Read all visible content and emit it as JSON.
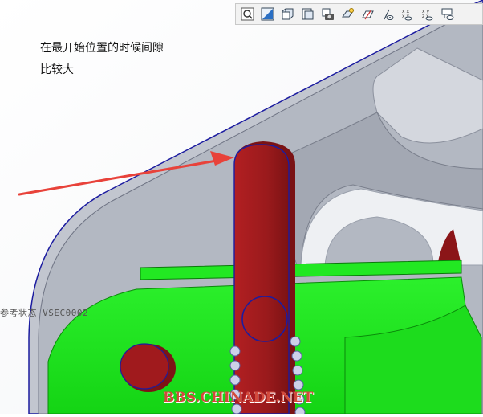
{
  "annotation": {
    "line1": "在最开始位置的时候间隙",
    "line2": "比较大"
  },
  "model_state_label": "参考状态 VSEC0002",
  "watermark": "BBS.CHINADE.NET",
  "toolbar": {
    "buttons": [
      {
        "icon": "zoom-icon"
      },
      {
        "icon": "shading-icon"
      },
      {
        "icon": "saved-view-icon"
      },
      {
        "icon": "view-manager-icon"
      },
      {
        "icon": "snapshot-icon"
      },
      {
        "icon": "datum-plane-icon"
      },
      {
        "icon": "datum-axis-icon"
      },
      {
        "icon": "datum-point-icon"
      },
      {
        "icon": "coordinate-system-icon"
      },
      {
        "icon": "annotation-icon"
      },
      {
        "icon": "spin-center-icon"
      }
    ]
  },
  "colors": {
    "bracket": "#b7bcc7",
    "pin": "#9c1a1d",
    "green_part": "#1ee61e",
    "arrow": "#e8423a",
    "edge": "#1c1ca0"
  }
}
